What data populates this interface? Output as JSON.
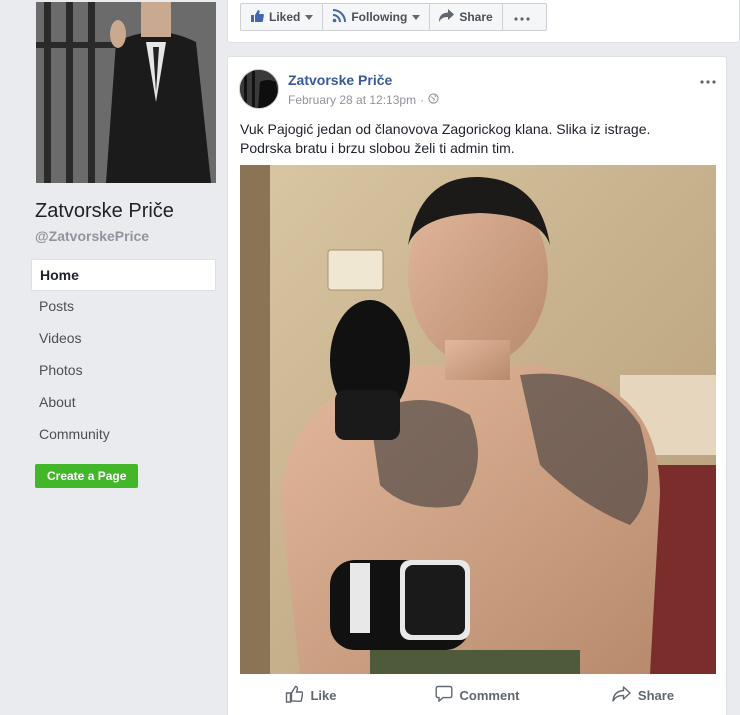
{
  "page": {
    "name": "Zatvorske Priče",
    "handle": "@ZatvorskePrice"
  },
  "nav": {
    "items": [
      {
        "label": "Home",
        "active": true
      },
      {
        "label": "Posts"
      },
      {
        "label": "Videos"
      },
      {
        "label": "Photos"
      },
      {
        "label": "About"
      },
      {
        "label": "Community"
      }
    ]
  },
  "create_page_label": "Create a Page",
  "action_bar": {
    "liked": "Liked",
    "following": "Following",
    "share": "Share",
    "more_icon": "more-dots-icon"
  },
  "post": {
    "author": "Zatvorske Priče",
    "timestamp": "February 28 at 12:13pm",
    "privacy_icon": "globe-icon",
    "text_line1": "Vuk Pajogić jedan od članovova Zagorickog klana. Slika iz istrage.",
    "text_line2": "Podrska bratu i brzu slobou želi ti admin tim.",
    "actions": {
      "like": "Like",
      "comment": "Comment",
      "share": "Share"
    }
  },
  "colors": {
    "link": "#385898",
    "green": "#42b72a",
    "background": "#e9ebee"
  }
}
